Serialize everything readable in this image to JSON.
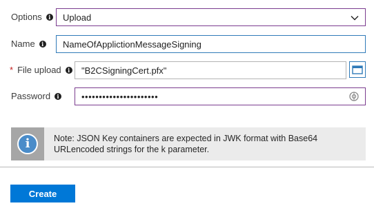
{
  "form": {
    "options": {
      "label": "Options",
      "value": "Upload"
    },
    "name": {
      "label": "Name",
      "value": "NameOfApplictionMessageSigning"
    },
    "file_upload": {
      "required_mark": "*",
      "label": "File upload",
      "value": "\"B2CSigningCert.pfx\""
    },
    "password": {
      "label": "Password",
      "value": "••••••••••••••••••••••"
    }
  },
  "note": {
    "icon": "info-icon",
    "text": "Note: JSON Key containers are expected in JWK format with Base64 URLencoded strings for the k parameter."
  },
  "actions": {
    "create_label": "Create"
  },
  "colors": {
    "accent_purple": "#7a3b8e",
    "accent_blue": "#2f7ab8",
    "button_blue": "#0078d7",
    "note_bg": "#ebebeb",
    "note_icon_bg": "#a6a6a6"
  }
}
